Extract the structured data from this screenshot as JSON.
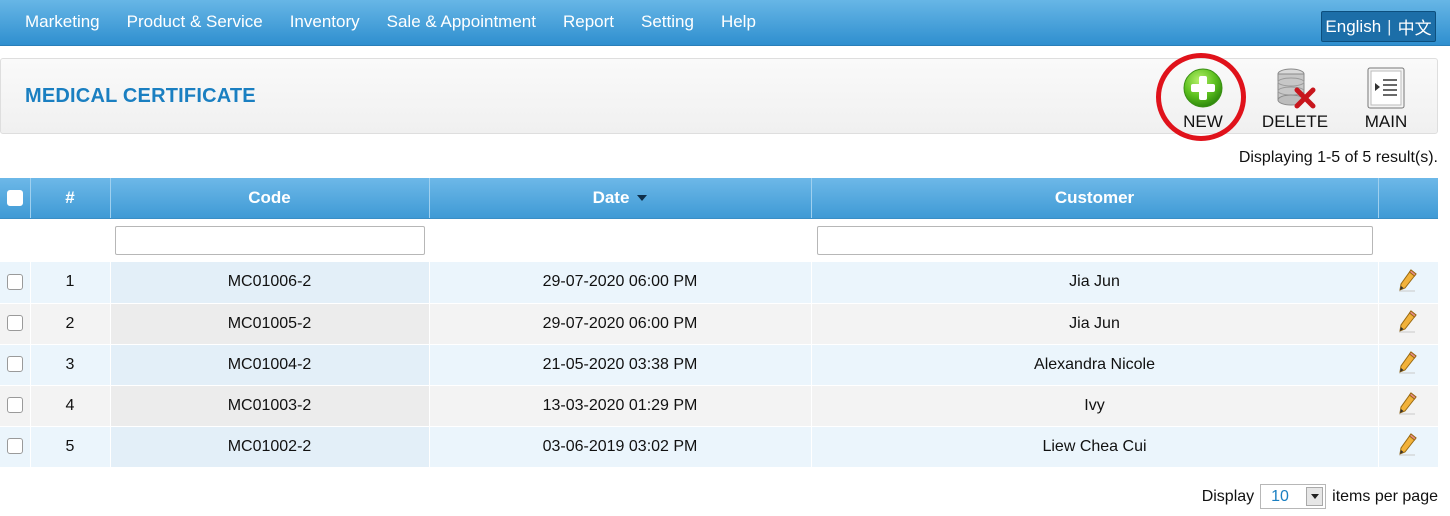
{
  "nav": {
    "items": [
      "Marketing",
      "Product & Service",
      "Inventory",
      "Sale & Appointment",
      "Report",
      "Setting",
      "Help"
    ],
    "lang_en": "English",
    "lang_sep": "|",
    "lang_zh": "中文"
  },
  "header": {
    "title": "MEDICAL CERTIFICATE",
    "new_label": "NEW",
    "delete_label": "DELETE",
    "main_label": "MAIN"
  },
  "result_info": "Displaying 1-5 of 5 result(s).",
  "table": {
    "columns": {
      "number": "#",
      "code": "Code",
      "date": "Date",
      "customer": "Customer"
    },
    "sorted_column": "Date",
    "rows": [
      {
        "n": "1",
        "code": "MC01006-2",
        "date": "29-07-2020 06:00 PM",
        "customer": "Jia Jun"
      },
      {
        "n": "2",
        "code": "MC01005-2",
        "date": "29-07-2020 06:00 PM",
        "customer": "Jia Jun"
      },
      {
        "n": "3",
        "code": "MC01004-2",
        "date": "21-05-2020 03:38 PM",
        "customer": "Alexandra Nicole"
      },
      {
        "n": "4",
        "code": "MC01003-2",
        "date": "13-03-2020 01:29 PM",
        "customer": "Ivy"
      },
      {
        "n": "5",
        "code": "MC01002-2",
        "date": "03-06-2019 03:02 PM",
        "customer": "Liew Chea Cui"
      }
    ]
  },
  "pager": {
    "display_label": "Display",
    "per_page_value": "10",
    "items_label": "items per page"
  },
  "icons": {
    "new": "plus-circle-icon",
    "delete": "database-delete-icon",
    "main": "list-icon",
    "edit": "pencil-icon"
  },
  "colors": {
    "nav_bar": "#3f9ad5",
    "title": "#1a7fc1",
    "table_header": "#4ea5dd",
    "highlight_ring": "#e0121b"
  }
}
